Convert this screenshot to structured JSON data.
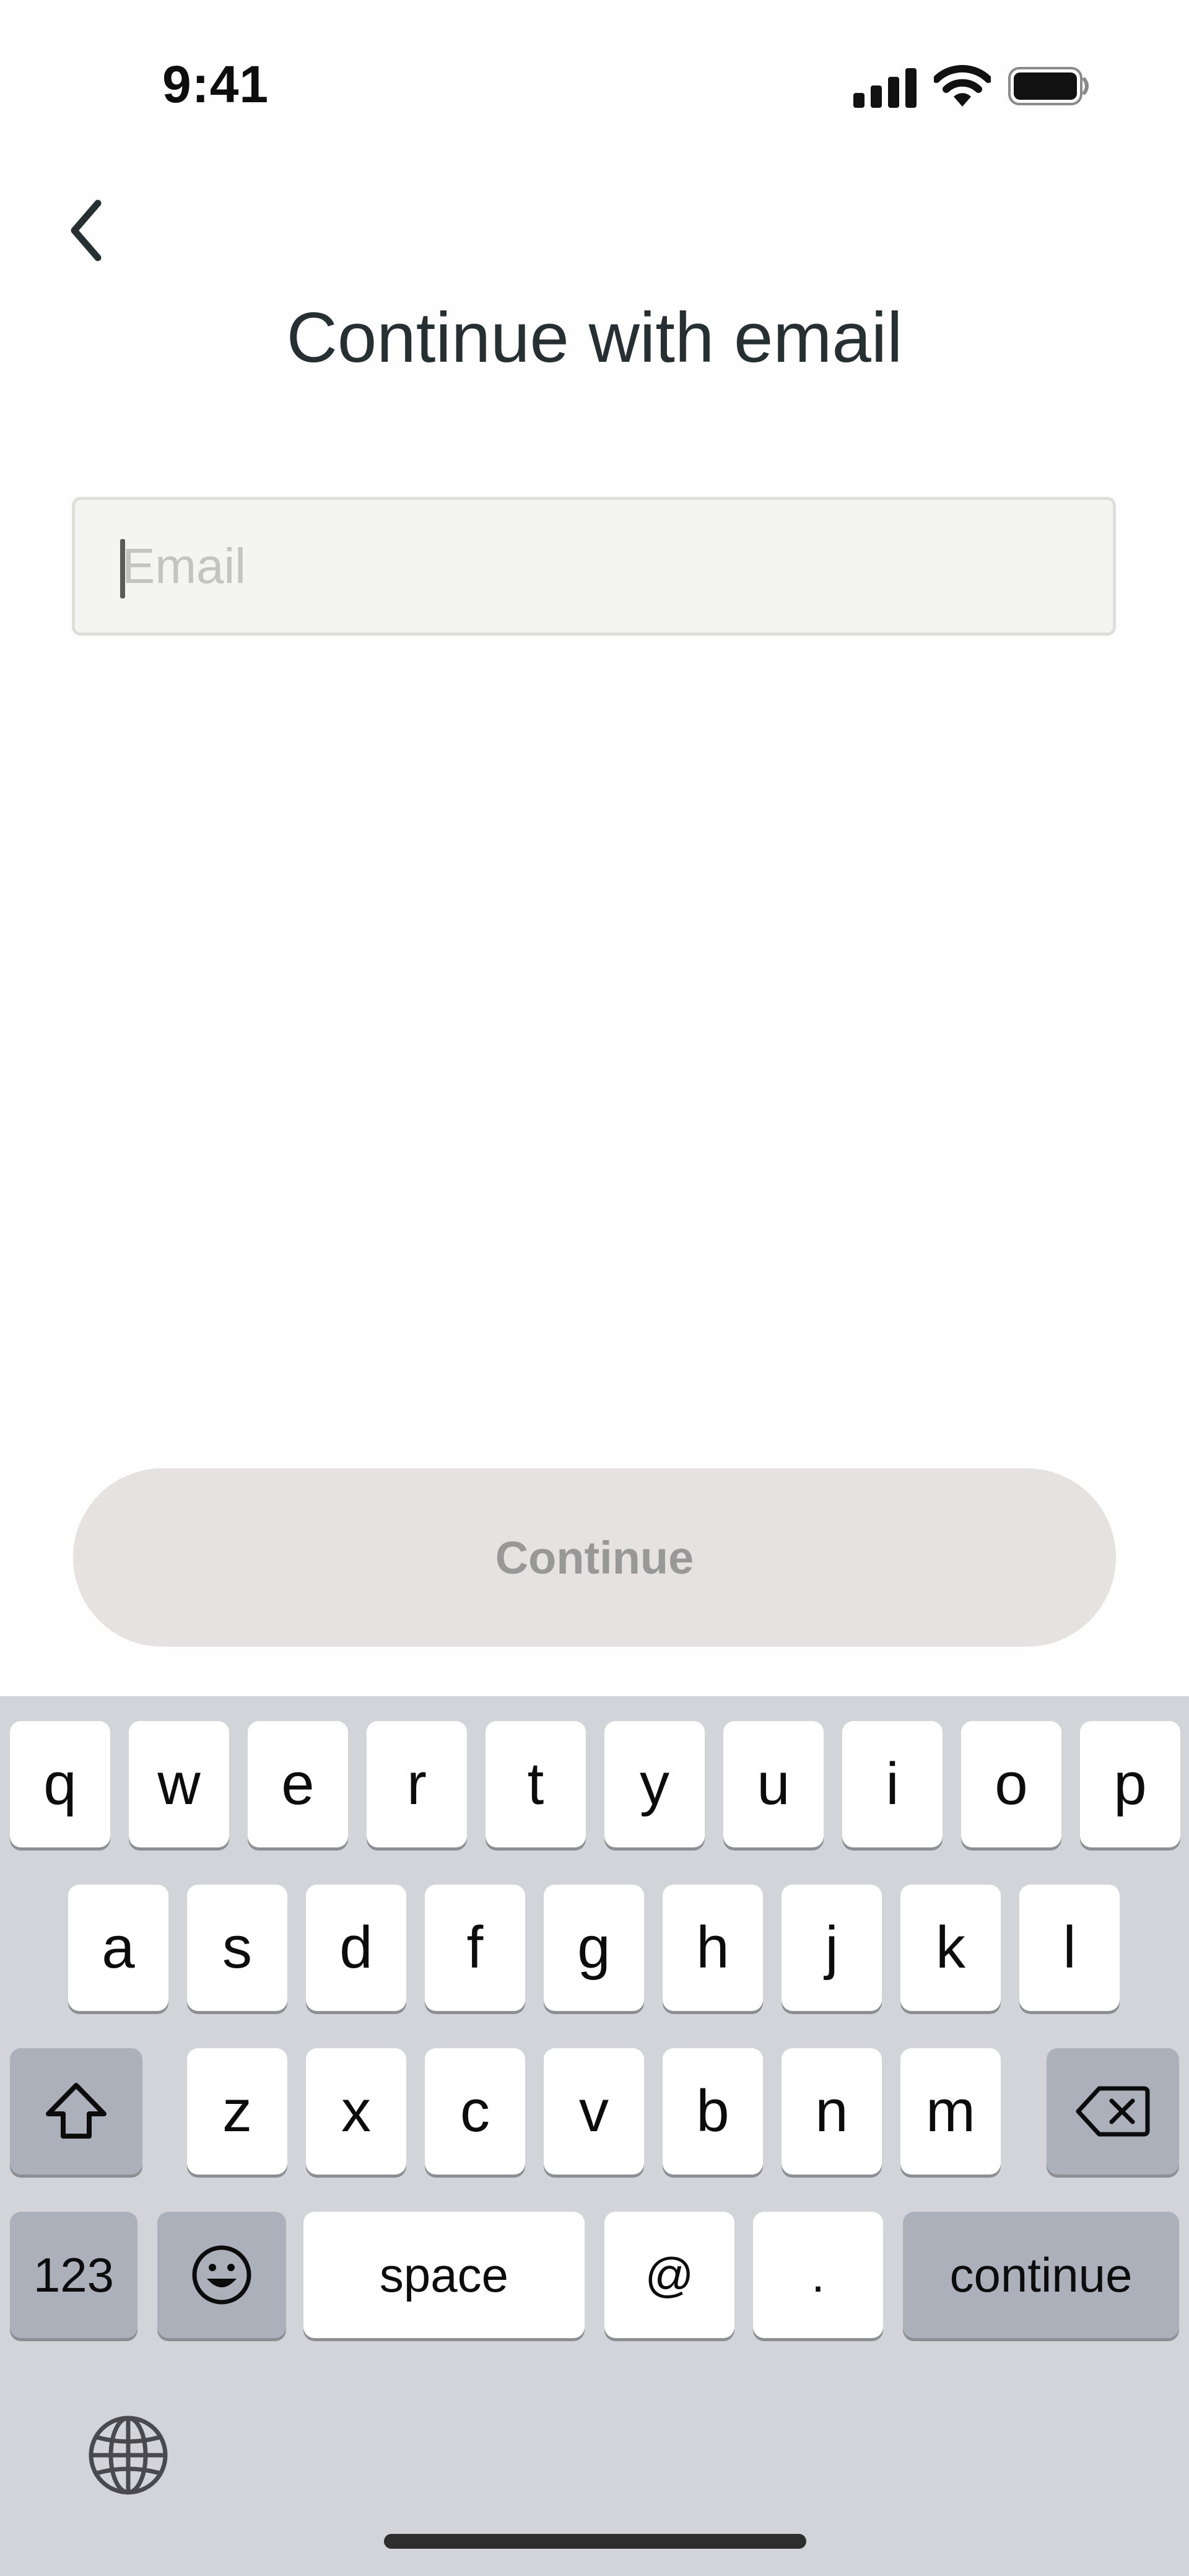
{
  "status_bar": {
    "time": "9:41",
    "icons": [
      "cellular-signal-icon",
      "wifi-icon",
      "battery-icon"
    ]
  },
  "header": {
    "back_icon": "chevron-left-icon",
    "title": "Continue with email"
  },
  "email": {
    "placeholder": "Email",
    "value": ""
  },
  "actions": {
    "continue_label": "Continue"
  },
  "keyboard": {
    "row1": [
      "q",
      "w",
      "e",
      "r",
      "t",
      "y",
      "u",
      "i",
      "o",
      "p"
    ],
    "row2": [
      "a",
      "s",
      "d",
      "f",
      "g",
      "h",
      "j",
      "k",
      "l"
    ],
    "row3": [
      "z",
      "x",
      "c",
      "v",
      "b",
      "n",
      "m"
    ],
    "numbers_label": "123",
    "space_label": "space",
    "at_label": "@",
    "dot_label": ".",
    "return_label": "continue",
    "icons": [
      "shift-icon",
      "delete-icon",
      "emoji-icon",
      "globe-icon"
    ]
  },
  "colors": {
    "title": "#263033",
    "button_bg": "#e5e2e1",
    "button_text": "#989898",
    "keyboard_bg": "#d3d4d9"
  }
}
